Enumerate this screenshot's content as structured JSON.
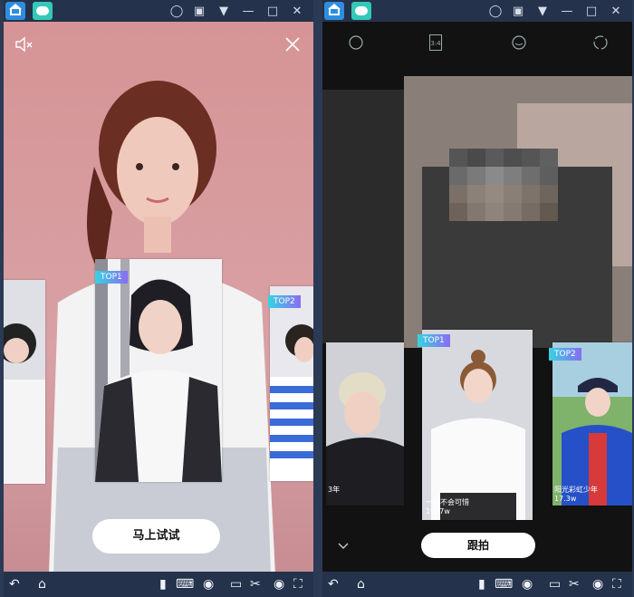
{
  "colors": {
    "emulator_bar": "#25324b",
    "badge_start": "#35d4e2",
    "badge_end": "#8a6cf3",
    "left_bg": "#d69496"
  },
  "left": {
    "top_icons": [
      "home-app-icon",
      "robot-app-icon",
      "account-icon",
      "gift-icon",
      "signal-icon",
      "minimize-icon",
      "maximize-icon",
      "close-window-icon"
    ],
    "mute_icon": "speaker-mute-icon",
    "close_icon": "close-icon",
    "cards": [
      {
        "badge": "",
        "subject": "person-left-partial"
      },
      {
        "badge": "TOP1",
        "subject": "person-bob-hair"
      },
      {
        "badge": "TOP2",
        "subject": "person-striped-shirt"
      }
    ],
    "cta_label": "马上试试"
  },
  "right": {
    "camera_icons": [
      "face-icon",
      "ratio-icon",
      "beauty-icon",
      "switch-camera-icon"
    ],
    "ratio_label": "3:4",
    "cards": [
      {
        "badge": "",
        "caption": "3年",
        "subject": "person-blond"
      },
      {
        "badge": "TOP1",
        "caption": "一首不会可惜",
        "count": "1927w",
        "subject": "person-white-tee"
      },
      {
        "badge": "TOP2",
        "caption": "阳光彩虹少年",
        "count": "17.3w",
        "subject": "person-cap"
      }
    ],
    "collapse_icon": "chevron-down-icon",
    "cta_label": "跟拍"
  },
  "bottombar": {
    "icons": [
      "back-icon",
      "home-icon",
      "phone-icon",
      "keyboard-icon",
      "eye-icon",
      "screen-icon",
      "scissors-icon",
      "location-icon",
      "fullscreen-icon"
    ]
  }
}
